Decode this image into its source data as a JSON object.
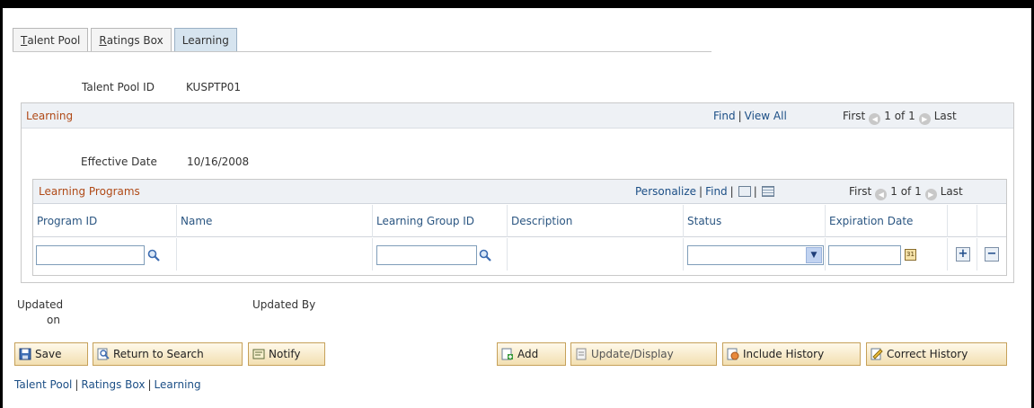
{
  "tabs": [
    {
      "label": "Talent Pool",
      "accel": "T",
      "rest": "alent Pool"
    },
    {
      "label": "Ratings Box",
      "accel": "R",
      "rest": "atings Box"
    },
    {
      "label": "Learning"
    }
  ],
  "header": {
    "talent_pool_id_label": "Talent Pool ID",
    "talent_pool_id_value": "KUSPTP01"
  },
  "learning_grid": {
    "title": "Learning",
    "find": "Find",
    "view_all": "View All",
    "first": "First",
    "count": "1 of 1",
    "last": "Last",
    "effective_date_label": "Effective Date",
    "effective_date_value": "10/16/2008"
  },
  "programs_grid": {
    "title": "Learning Programs",
    "personalize": "Personalize",
    "find": "Find",
    "first": "First",
    "count": "1 of 1",
    "last": "Last",
    "columns": [
      "Program ID",
      "Name",
      "Learning Group ID",
      "Description",
      "Status",
      "Expiration Date"
    ],
    "row": {
      "program_id": "",
      "name": "",
      "learning_group_id": "",
      "description": "",
      "status": "",
      "expiration_date": ""
    }
  },
  "audit": {
    "updated_on_label_1": "Updated",
    "updated_on_label_2": "on",
    "updated_by_label": "Updated By"
  },
  "toolbar": {
    "save": "Save",
    "return_to_search": "Return to Search",
    "notify": "Notify",
    "add": "Add",
    "update_display": "Update/Display",
    "include_history": "Include History",
    "correct_history": "Correct History"
  },
  "footer_links": [
    "Talent Pool",
    "Ratings Box",
    "Learning"
  ],
  "colors": {
    "grid_title": "#b04a17",
    "link": "#1c4f86",
    "active_tab": "#d6e4ef"
  }
}
